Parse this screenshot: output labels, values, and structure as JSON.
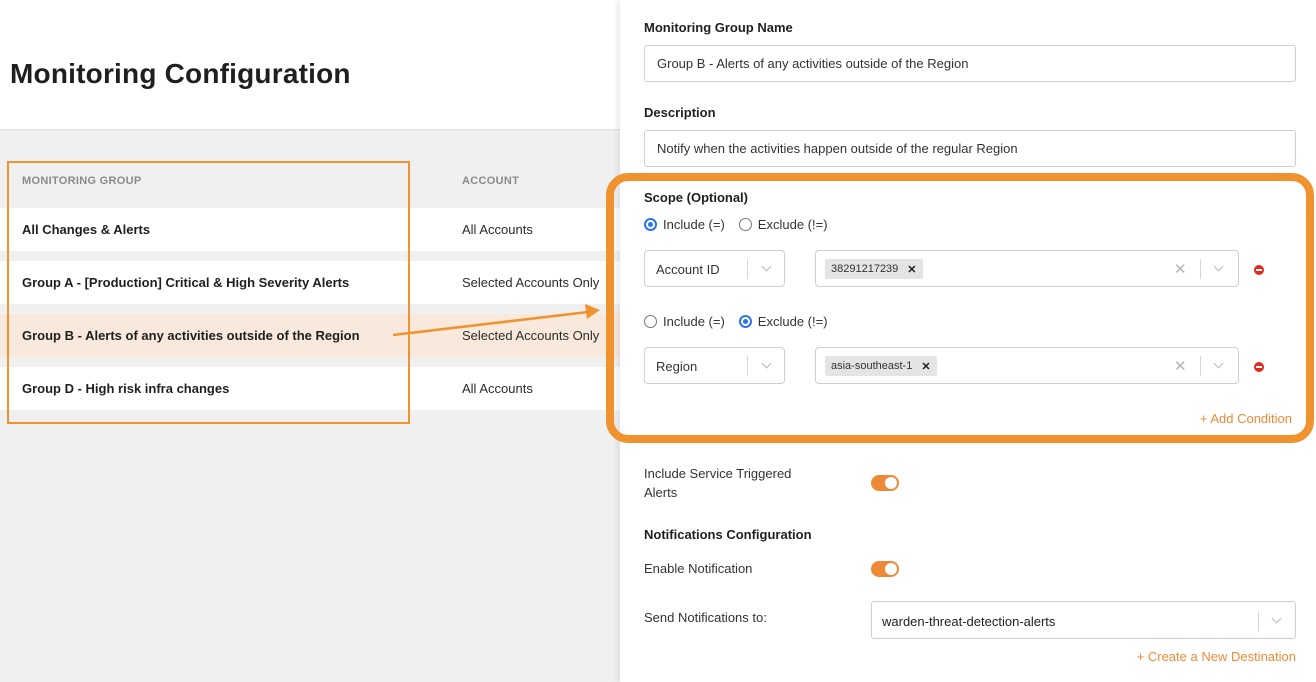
{
  "page": {
    "title": "Monitoring Configuration"
  },
  "table": {
    "columns": [
      "MONITORING GROUP",
      "ACCOUNT"
    ],
    "rows": [
      {
        "group": "All Changes & Alerts",
        "account": "All Accounts",
        "selected": false
      },
      {
        "group": "Group A - [Production] Critical & High Severity Alerts",
        "account": "Selected Accounts Only",
        "selected": false
      },
      {
        "group": "Group B - Alerts of any activities outside of the Region",
        "account": "Selected Accounts Only",
        "selected": true
      },
      {
        "group": "Group D - High risk infra changes",
        "account": "All Accounts",
        "selected": false
      }
    ]
  },
  "panel": {
    "name_label": "Monitoring Group Name",
    "name_value": "Group B - Alerts of any activities outside of the Region",
    "description_label": "Description",
    "description_value": "Notify when the activities happen outside of the regular Region",
    "scope": {
      "label": "Scope (Optional)",
      "include_label": "Include (=)",
      "exclude_label": "Exclude (!=)",
      "conditions": [
        {
          "mode": "include",
          "field": "Account ID",
          "values": [
            "38291217239"
          ]
        },
        {
          "mode": "exclude",
          "field": "Region",
          "values": [
            "asia-southeast-1"
          ]
        }
      ],
      "add_condition": "+ Add Condition"
    },
    "service_triggered": {
      "label": "Include Service Triggered Alerts",
      "enabled": true
    },
    "notifications": {
      "heading": "Notifications Configuration",
      "enable_label": "Enable Notification",
      "enabled": true,
      "send_to_label": "Send Notifications to:",
      "destination": "warden-threat-detection-alerts",
      "create_destination": "+ Create a New Destination"
    }
  },
  "colors": {
    "accent_orange": "#ee8a37",
    "highlight_orange": "#f0922e",
    "radio_blue": "#2a74f0",
    "remove_red": "#e4281e",
    "selected_row": "#f9e9dc"
  }
}
